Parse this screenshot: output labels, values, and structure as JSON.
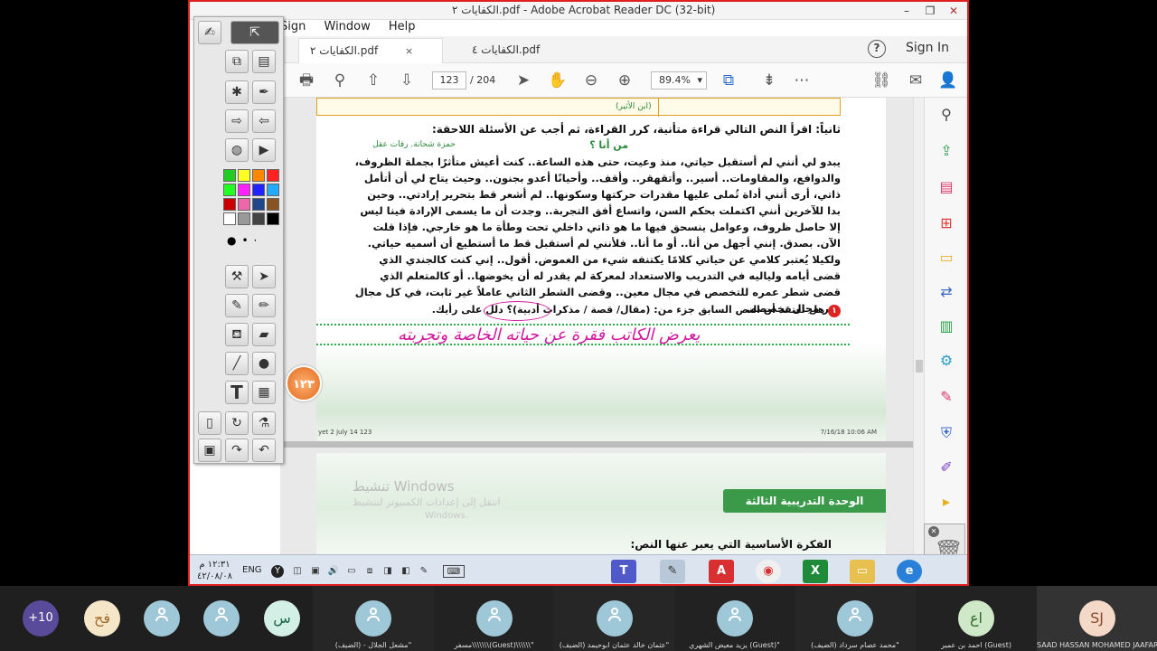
{
  "window": {
    "title": "الكفايات ٢.pdf - Adobe Acrobat Reader DC (32-bit)",
    "menu": [
      "Sign",
      "Window",
      "Help"
    ],
    "sign_in": "Sign In",
    "help_icon": "?"
  },
  "tabs": [
    {
      "label": "الكفايات ٢.pdf",
      "active": true,
      "close": "×"
    },
    {
      "label": "الكفايات ٤.pdf",
      "active": false
    }
  ],
  "toolbar": {
    "page_current": "123",
    "page_total": "/ 204",
    "zoom": "89.4%",
    "zoom_arrow": "▾"
  },
  "document": {
    "source_label": "(ابن الأثير)",
    "heading": "ثانياً: اقرأ النص التالي قراءة متأنية، كرر القراءة، ثم أجب عن الأسئلة اللاحقة:",
    "subtitle": "من أنا ؟",
    "author": "حمزة شحاتة. رفات عقل",
    "para1": "يبدو لي أنني لم أستقبل حياتي، منذ وعيت، حتى هذه الساعة.. كنت أعيش متأثرًا بجملة الظروف، والدوافع، والمقاومات.. أسير.. وأتقهقر.. وأقف.. وأحيانًا أعدو بجنون.. وحيث يتاح لي أن أتأمل ذاتي، أرى أنني أداة تُملى عليها مقدرات حركتها وسكونها.. لم أشعر قط بتحرير إرادتي.. وحين بدا للآخرين أنني اكتملت بحكم السن، واتساع أفق التجربة.. وجدت أن ما يسمى الإرادة فينا ليس إلا حاصل ظروف، وعوامل ينسحق فيها ما هو ذاتي داخلي تحت وطأة ما هو خارجي. فإذا قلت الآن. بصدق. إنني أجهل من أنا.. أو ما أنا.. فلأنني لم أستقبل قط ما أستطيع أن أسميه حياتي.",
    "para2": "ولكيلا يُعتبر كلامي عن حياتي كلامًا يكتنفه شيء من الغموض. أقول.. إني كنت كالجندي الذي قضى أيامه ولياليه في التدريب والاستعداد لمعركة لم يقدر له أن يخوضها.. أو كالمتعلم الذي قضى شطر عمره للتخصص في مجال معين.. وقضى الشطر الثاني عاملاً غير ثابت، في كل مجال غير مجال تخصصه.",
    "question_num": "١",
    "question": "هل تعتقد أن النص السابق جزء من: (مقال/ قصة / مذكرات أدبية)؟ دلل على رأيك.",
    "handwriting": "يعرض الكاتب فقرة عن حياته الخاصة وتجربته",
    "footer_left": "yet 2 july 14   123",
    "footer_right": "7/16/18   10:06 AM",
    "unit_title": "الوحدة التدريبية الثالثة",
    "question2": "الفكرة الأساسية التي يعبر عنها النص:"
  },
  "watermark": {
    "line1": "تنشيط Windows",
    "line2": "انتقل إلى إعدادات الكمبيوتر لتنشيط",
    "line3": "Windows."
  },
  "smart_toolbar": {
    "page_badge": "١٢٣",
    "colors": [
      "#22cc22",
      "#ffff22",
      "#ff8800",
      "#ff2222",
      "#22ff22",
      "#ff22ff",
      "#2222ff",
      "#22aaff",
      "#cc0000",
      "#ee66aa",
      "#224488",
      "#885522",
      "#ffffff",
      "#999999",
      "#444444",
      "#000000"
    ],
    "text_tool": "T"
  },
  "taskbar": {
    "time": "١٢:٣١ م",
    "date": "٤٢/٠٨/٠٨",
    "lang": "ENG"
  },
  "participants": [
    {
      "initials": "+10",
      "name": "",
      "color": "#5a4a9a"
    },
    {
      "initials": "فح",
      "name": "",
      "color": "#f5e6c8"
    },
    {
      "initials": "",
      "name": "",
      "color": "#9ec8d8"
    },
    {
      "initials": "",
      "name": "",
      "color": "#9ec8d8"
    },
    {
      "initials": "س",
      "name": "",
      "color": "#d4efe6"
    },
    {
      "initials": "",
      "name": "مشعل الجلال - (الضيف)\"",
      "color": "#9ec8d8"
    },
    {
      "initials": "",
      "name": "مسفر\\\\\\\\\\\\\\(Guest)\\\\\\\\\\\\\"",
      "color": "#9ec8d8"
    },
    {
      "initials": "",
      "name": "عثمان خالد عثمان ابوحيمد (الضيف)\"",
      "color": "#9ec8d8"
    },
    {
      "initials": "",
      "name": "يزيد معيض الشهري (Guest)\"",
      "color": "#9ec8d8"
    },
    {
      "initials": "",
      "name": "محمد عصام سرداد (الضيف)\"",
      "color": "#9ec8d8"
    },
    {
      "initials": "اع",
      "name": "احمد بن عمير (Guest)",
      "color": "#cfe8c8"
    },
    {
      "initials": "SJ",
      "name": "SAAD HASSAN MOHAMED JAAFAR",
      "color": "#f4d8c8"
    }
  ]
}
